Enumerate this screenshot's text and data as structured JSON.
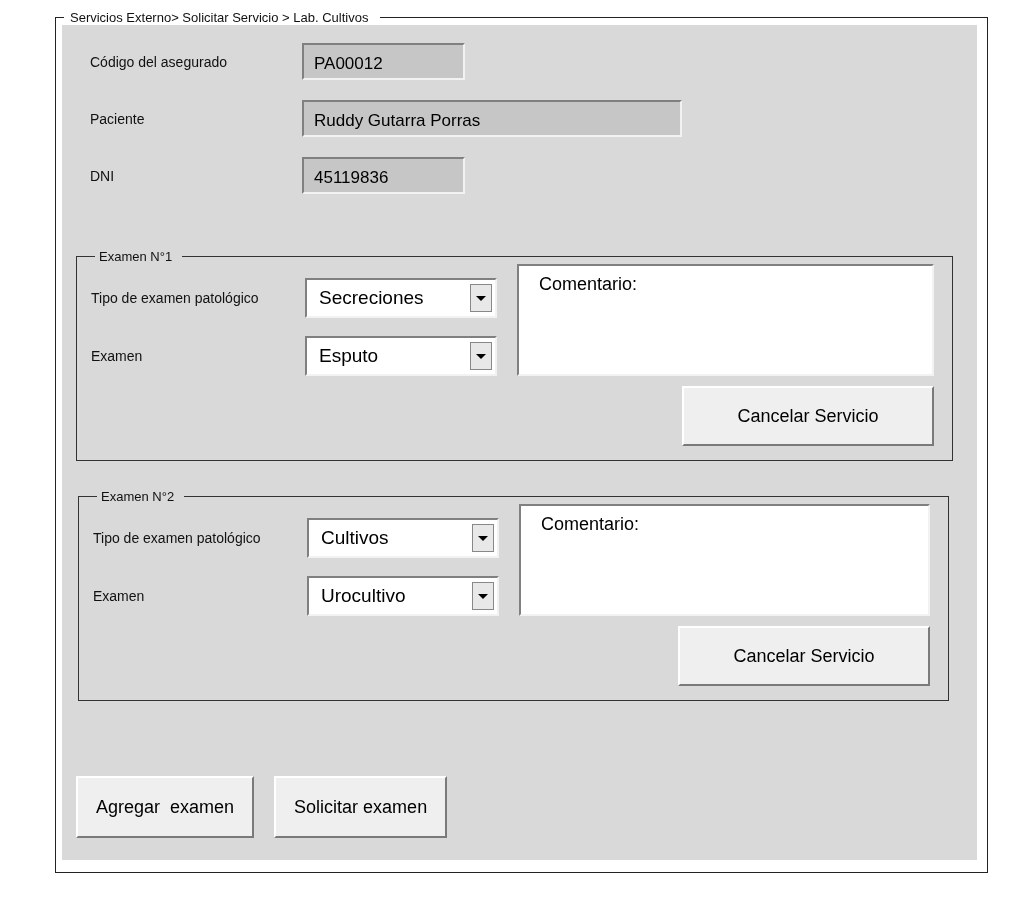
{
  "breadcrumb": "Servicios Externo> Solicitar Servicio > Lab. Cultivos",
  "patient_fields": [
    {
      "label": "Código del asegurado",
      "value": "PA00012",
      "kind": "short"
    },
    {
      "label": "Paciente",
      "value": "Ruddy Gutarra Porras",
      "kind": "long"
    },
    {
      "label": "DNI",
      "value": "45119836",
      "kind": "short"
    }
  ],
  "exams": [
    {
      "title": "Examen N°1",
      "type_label": "Tipo de examen patológico",
      "type_value": "Secreciones",
      "exam_label": "Examen",
      "exam_value": "Esputo",
      "comment": "Comentario:",
      "cancel_button": "Cancelar Servicio"
    },
    {
      "title": "Examen N°2",
      "type_label": "Tipo de examen patológico",
      "type_value": "Cultivos",
      "exam_label": "Examen",
      "exam_value": "Urocultivo",
      "comment": "Comentario:",
      "cancel_button": "Cancelar Servicio"
    }
  ],
  "buttons": [
    "Agregar  examen",
    "Solicitar examen"
  ]
}
